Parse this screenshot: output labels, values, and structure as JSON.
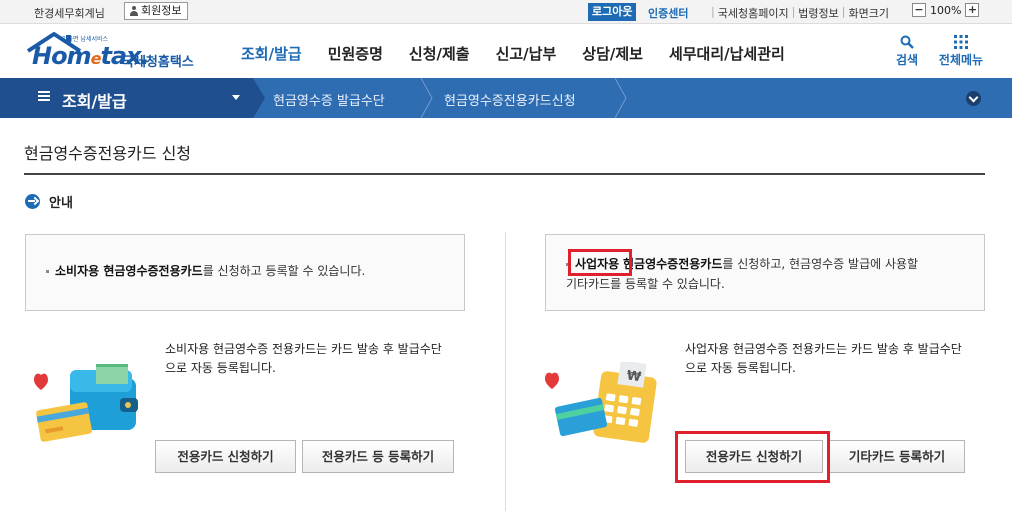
{
  "topbar": {
    "user_name": "한경세무회계님",
    "member_info": "회원정보",
    "logout": "로그아웃",
    "certificate_center": "인증센터",
    "links": [
      "국세청홈페이지",
      "법령정보",
      "화면크기"
    ],
    "zoom_minus": "−",
    "zoom_value": "100%",
    "zoom_plus": "+"
  },
  "header": {
    "logo_tagline": "안하면 납세서비스",
    "logo_word_1": "Hom",
    "logo_word_e": "e",
    "logo_word_2": "tax.",
    "logo_korean": "국세청홈택스",
    "nav": [
      "조회/발급",
      "민원증명",
      "신청/제출",
      "신고/납부",
      "상담/제보",
      "세무대리/납세관리"
    ],
    "search_label": "검색",
    "all_menu_label": "전체메뉴"
  },
  "breadcrumb": {
    "section": "조회/발급",
    "crumbs": [
      "현금영수증 발급수단",
      "현금영수증전용카드신청"
    ]
  },
  "page": {
    "title": "현금영수증전용카드 신청",
    "guide_label": "안내"
  },
  "left_panel": {
    "info_bold": "소비자용 현금영수증전용카드",
    "info_rest": "를 신청하고 등록할 수 있습니다.",
    "desc_line1": "소비자용 현금영수증 전용카드는 카드 발송 후 발급수단",
    "desc_line2": "으로 자동 등록됩니다.",
    "btn_apply": "전용카드 신청하기",
    "btn_register": "전용카드 등 등록하기"
  },
  "right_panel": {
    "info_highlight": "사업자용",
    "info_bold": "현금영수증전용카드",
    "info_rest_line1": "를 신청하고, 현금영수증 발급에 사용할",
    "info_rest_line2": "기타카드를 등록할 수 있습니다.",
    "desc_line1": "사업자용 현금영수증 전용카드는 카드 발송 후 발급수단",
    "desc_line2": "으로 자동 등록됩니다.",
    "btn_apply": "전용카드 신청하기",
    "btn_register": "기타카드 등록하기"
  },
  "colors": {
    "brand_blue": "#1d6bb5",
    "breadcrumb_bg": "#2f6db3",
    "breadcrumb_lead": "#1f4f8e",
    "highlight_red": "#e0202a"
  },
  "icons": [
    "person-icon",
    "search-icon",
    "grid-menu-icon",
    "hamburger-icon",
    "chevron-down-icon",
    "arrow-circle-icon",
    "wallet-card-icon",
    "calculator-card-icon",
    "heart-icon"
  ]
}
